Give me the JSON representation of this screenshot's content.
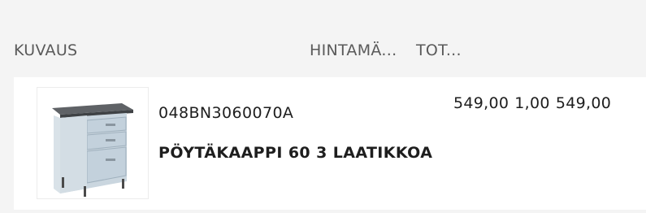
{
  "table": {
    "headers": {
      "description": "KUVAUS",
      "unit_price": "HINTAMÄ...",
      "total": "TOT..."
    },
    "items": [
      {
        "sku": "048BN3060070A",
        "name": "PÖYTÄKAAPPI 60 3 LAATIKKOA",
        "unit_price": "549,00",
        "quantity": "1,00",
        "total": "549,00",
        "thumbnail_icon": "base-cabinet-3-drawers-image"
      }
    ]
  }
}
